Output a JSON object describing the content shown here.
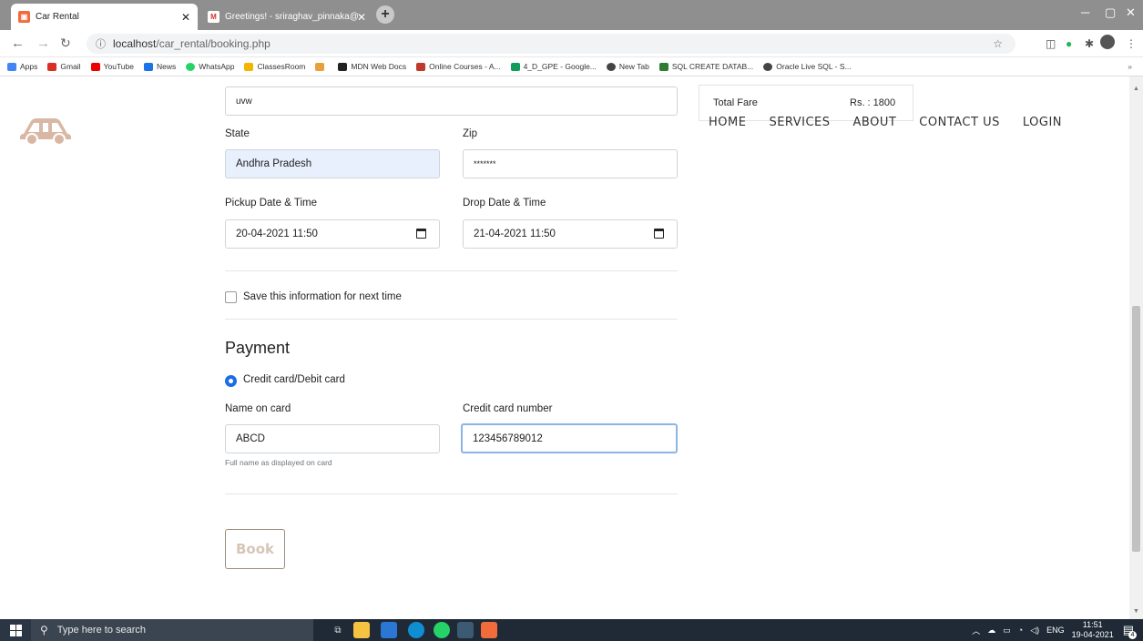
{
  "browser": {
    "tabs": [
      {
        "title": "Car Rental",
        "active": true
      },
      {
        "title": "Greetings! - sriraghav_pinnaka@",
        "active": false
      }
    ],
    "url_host": "localhost",
    "url_path": "/car_rental/booking.php",
    "bookmarks": [
      "Apps",
      "Gmail",
      "YouTube",
      "News",
      "WhatsApp",
      "ClassesRoom",
      "",
      "MDN Web Docs",
      "Online Courses - A...",
      "4_D_GPE - Google...",
      "New Tab",
      "SQL CREATE DATAB...",
      "Oracle Live SQL - S..."
    ]
  },
  "nav": {
    "home": "HOME",
    "services": "SERVICES",
    "about": "ABOUT",
    "contact": "CONTACT US",
    "login": "LOGIN"
  },
  "fare": {
    "label": "Total Fare",
    "amount": "Rs. : 1800"
  },
  "form": {
    "address2_value": "uvw",
    "state_label": "State",
    "state_value": "Andhra Pradesh",
    "zip_label": "Zip",
    "zip_value": "*******",
    "pickup_label": "Pickup Date & Time",
    "pickup_value": "20-04-2021 11:50",
    "drop_label": "Drop Date & Time",
    "drop_value": "21-04-2021 11:50",
    "save_info_label": "Save this information for next time",
    "payment_heading": "Payment",
    "payment_method": "Credit card/Debit card",
    "name_label": "Name on card",
    "name_value": "ABCD",
    "name_hint": "Full name as displayed on card",
    "cc_label": "Credit card number",
    "cc_value": "123456789012",
    "book_button": "Book"
  },
  "taskbar": {
    "search_placeholder": "Type here to search",
    "lang": "ENG",
    "time": "11:51",
    "date": "19-04-2021",
    "notif_count": "4"
  },
  "colors": {
    "accent": "#d8b8a4",
    "radio": "#1a6ce8",
    "button_border": "#9e8b7e"
  }
}
